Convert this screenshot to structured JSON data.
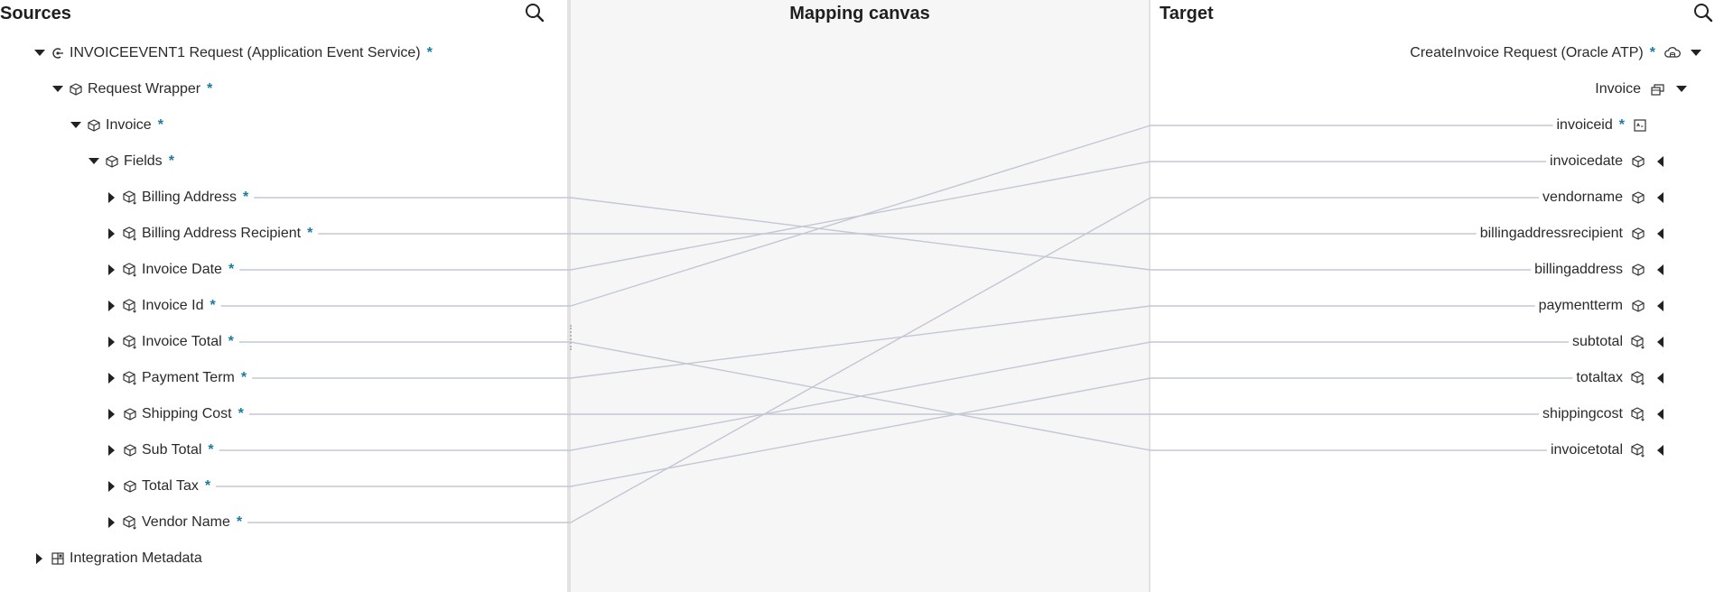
{
  "sources": {
    "title": "Sources",
    "root": {
      "label": "INVOICEEVENT1 Request (Application Event Service)",
      "required": "*"
    },
    "wrapper": {
      "label": "Request Wrapper",
      "required": "*"
    },
    "invoice": {
      "label": "Invoice",
      "required": "*"
    },
    "fields": {
      "label": "Fields",
      "required": "*"
    },
    "items": [
      {
        "label": "Billing Address",
        "required": "*"
      },
      {
        "label": "Billing Address Recipient",
        "required": "*"
      },
      {
        "label": "Invoice Date",
        "required": "*"
      },
      {
        "label": "Invoice Id",
        "required": "*"
      },
      {
        "label": "Invoice Total",
        "required": "*"
      },
      {
        "label": "Payment Term",
        "required": "*"
      },
      {
        "label": "Shipping Cost",
        "required": "*"
      },
      {
        "label": "Sub Total",
        "required": "*"
      },
      {
        "label": "Total Tax",
        "required": "*"
      },
      {
        "label": "Vendor Name",
        "required": "*"
      }
    ],
    "metadata": {
      "label": "Integration Metadata"
    }
  },
  "canvas": {
    "title": "Mapping canvas"
  },
  "target": {
    "title": "Target",
    "root": {
      "label": "CreateInvoice Request (Oracle ATP)",
      "required": "*"
    },
    "invoice": {
      "label": "Invoice"
    },
    "items": [
      {
        "label": "invoiceid",
        "required": "*"
      },
      {
        "label": "invoicedate"
      },
      {
        "label": "vendorname"
      },
      {
        "label": "billingaddressrecipient"
      },
      {
        "label": "billingaddress"
      },
      {
        "label": "paymentterm"
      },
      {
        "label": "subtotal"
      },
      {
        "label": "totaltax"
      },
      {
        "label": "shippingcost"
      },
      {
        "label": "invoicetotal"
      }
    ]
  },
  "mappings": [
    {
      "source": "Billing Address",
      "target": "billingaddress"
    },
    {
      "source": "Billing Address Recipient",
      "target": "billingaddressrecipient"
    },
    {
      "source": "Invoice Date",
      "target": "invoicedate"
    },
    {
      "source": "Invoice Id",
      "target": "invoiceid"
    },
    {
      "source": "Invoice Total",
      "target": "invoicetotal"
    },
    {
      "source": "Payment Term",
      "target": "paymentterm"
    },
    {
      "source": "Shipping Cost",
      "target": "shippingcost"
    },
    {
      "source": "Sub Total",
      "target": "subtotal"
    },
    {
      "source": "Total Tax",
      "target": "totaltax"
    },
    {
      "source": "Vendor Name",
      "target": "vendorname"
    }
  ],
  "colors": {
    "required": "#1b7aa0",
    "link": "#c2c7d3",
    "canvas": "#f6f6f6"
  }
}
